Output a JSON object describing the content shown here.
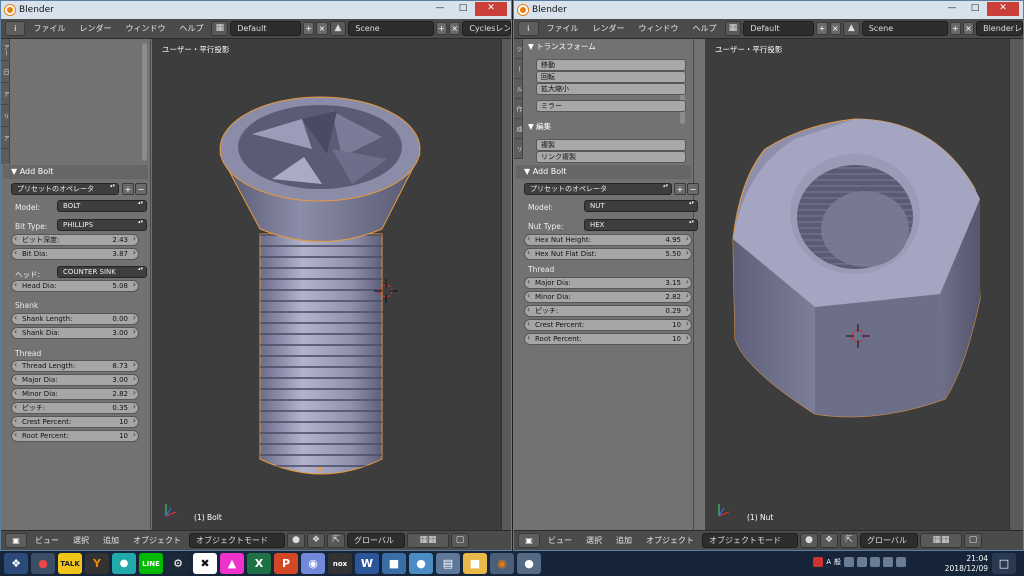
{
  "left": {
    "title": "Blender",
    "menus": [
      "ファイル",
      "レンダー",
      "ウィンドウ",
      "ヘルプ"
    ],
    "layout": "Default",
    "scene": "Scene",
    "engine": "Cyclesレンダ",
    "tabs": [
      "アー",
      "日",
      "ア",
      "リ",
      "ア"
    ],
    "panel_title": "Add Bolt",
    "preset": "プリセットのオペレータ",
    "model_label": "Model:",
    "model_value": "BOLT",
    "bit_type_label": "Bit Type:",
    "bit_type_value": "PHILLIPS",
    "bit_depth_label": "ビット深度:",
    "bit_depth_value": "2.43",
    "bit_dia_label": "Bit Dia:",
    "bit_dia_value": "3.87",
    "head_label": "ヘッド:",
    "head_value": "COUNTER SINK",
    "head_dia_label": "Head Dia:",
    "head_dia_value": "5.08",
    "shank_section": "Shank",
    "shank_length_label": "Shank Length:",
    "shank_length_value": "0.00",
    "shank_dia_label": "Shank Dia:",
    "shank_dia_value": "3.00",
    "thread_section": "Thread",
    "thread_length_label": "Thread Length:",
    "thread_length_value": "8.73",
    "major_dia_label": "Major Dia:",
    "major_dia_value": "3.00",
    "minor_dia_label": "Minor Dia:",
    "minor_dia_value": "2.82",
    "pitch_label": "ピッチ:",
    "pitch_value": "0.35",
    "crest_label": "Crest Percent:",
    "crest_value": "10",
    "root_label": "Root Percent:",
    "root_value": "10",
    "view_label": "ユーザー・平行投影",
    "object_label": "(1) Bolt",
    "bottom_menus": [
      "ビュー",
      "選択",
      "追加",
      "オブジェクト"
    ],
    "mode": "オブジェクトモード",
    "orientation": "グローバル"
  },
  "right": {
    "title": "Blender",
    "menus": [
      "ファイル",
      "レンダー",
      "ウィンドウ",
      "ヘルプ"
    ],
    "layout": "Default",
    "scene": "Scene",
    "engine": "Blenderレン",
    "tabs": [
      "ツ",
      "ー",
      "ル",
      "作",
      "成",
      "リ"
    ],
    "transform_title": "トランスフォーム",
    "translate": "移動",
    "rotate": "回転",
    "scale": "拡大縮小",
    "mirror": "ミラー",
    "edit_title": "編集",
    "duplicate": "複製",
    "duplicate_linked": "リンク複製",
    "panel_title": "Add Bolt",
    "preset": "プリセットのオペレータ",
    "model_label": "Model:",
    "model_value": "NUT",
    "nut_type_label": "Nut Type:",
    "nut_type_value": "HEX",
    "hex_height_label": "Hex Nut Height:",
    "hex_height_value": "4.95",
    "hex_flat_label": "Hex Nut Flat Dist:",
    "hex_flat_value": "5.50",
    "thread_section": "Thread",
    "major_dia_label": "Major Dia:",
    "major_dia_value": "3.15",
    "minor_dia_label": "Minor Dia:",
    "minor_dia_value": "2.82",
    "pitch_label": "ピッチ:",
    "pitch_value": "0.29",
    "crest_label": "Crest Percent:",
    "crest_value": "10",
    "root_label": "Root Percent:",
    "root_value": "10",
    "view_label": "ユーザー・平行投影",
    "object_label": "(1) Nut",
    "bottom_menus": [
      "ビュー",
      "選択",
      "追加",
      "オブジェクト"
    ],
    "mode": "オブジェクトモード",
    "orientation": "グローバル"
  },
  "taskbar": {
    "time": "21:04",
    "date": "2018/12/09",
    "ime_a": "A",
    "ime_b": "般"
  }
}
